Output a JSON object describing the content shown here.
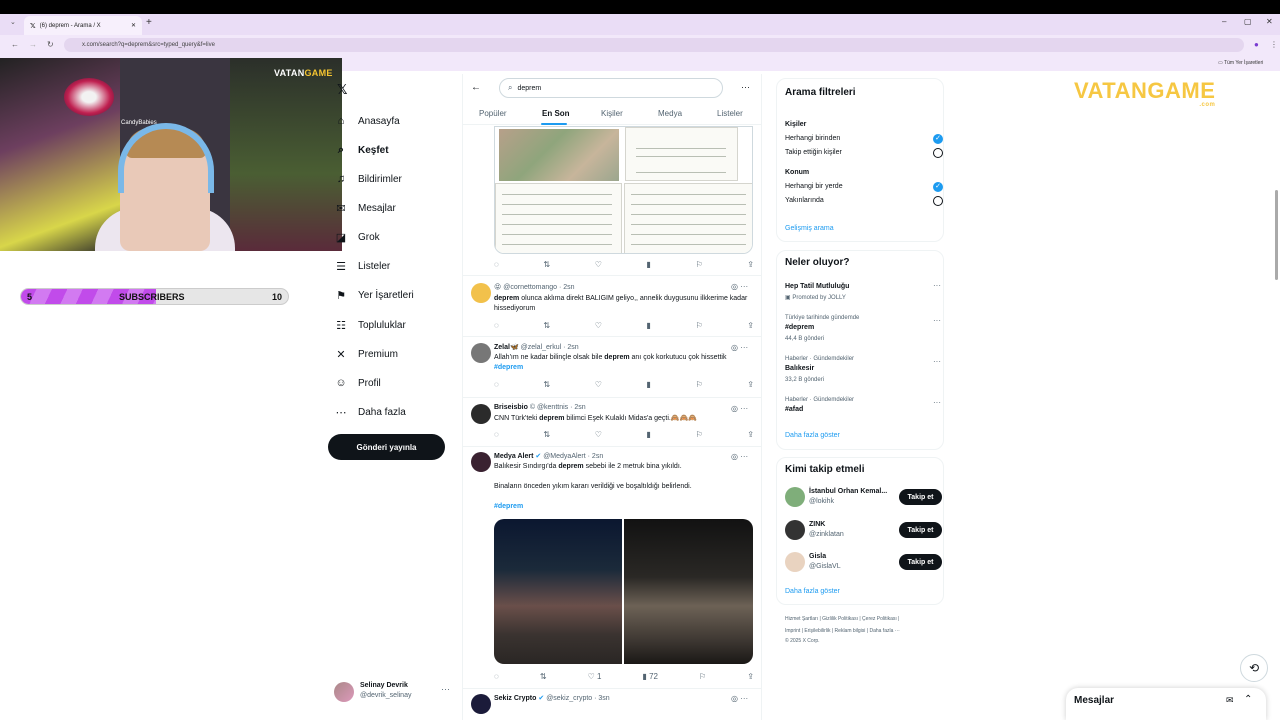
{
  "browser": {
    "tab_title": "(6) deprem - Arama / X",
    "new_tab": "+",
    "url": "x.com/search?q=deprem&src=typed_query&f=live",
    "bookmarks_right": "Tüm Yer İşaretleri",
    "window_min": "–",
    "window_max": "▢",
    "window_close": "✕"
  },
  "stream": {
    "cam_name": "CandyBabies",
    "logo_a": "VATAN",
    "logo_b": "GAME",
    "subs_current": "5",
    "subs_label": "SUBSCRIBERS",
    "subs_goal": "10",
    "subs_fraction": 0.5,
    "right_logo": "VATANGAME",
    "right_logo_sub": ".com"
  },
  "nav": {
    "items": [
      {
        "icon": "home-icon",
        "glyph": "⌂",
        "label": "Anasayfa"
      },
      {
        "icon": "explore-icon",
        "glyph": "⌕",
        "label": "Keşfet"
      },
      {
        "icon": "bell-icon",
        "glyph": "♫",
        "label": "Bildirimler"
      },
      {
        "icon": "mail-icon",
        "glyph": "✉",
        "label": "Mesajlar"
      },
      {
        "icon": "grok-icon",
        "glyph": "◪",
        "label": "Grok"
      },
      {
        "icon": "list-icon",
        "glyph": "☰",
        "label": "Listeler"
      },
      {
        "icon": "bookmark-icon",
        "glyph": "⚑",
        "label": "Yer İşaretleri"
      },
      {
        "icon": "communities-icon",
        "glyph": "☷",
        "label": "Topluluklar"
      },
      {
        "icon": "x-premium-icon",
        "glyph": "✕",
        "label": "Premium"
      },
      {
        "icon": "profile-icon",
        "glyph": "☺",
        "label": "Profil"
      },
      {
        "icon": "more-icon",
        "glyph": "⋯",
        "label": "Daha fazla"
      }
    ],
    "post_button": "Gönderi yayınla",
    "account_name": "Selinay Devrik",
    "account_handle": "@devrik_selinay"
  },
  "search": {
    "query": "deprem",
    "tabs": [
      "Popüler",
      "En Son",
      "Kişiler",
      "Medya",
      "Listeler"
    ],
    "active_tab": "En Son"
  },
  "tweets": [
    {
      "emoji": "😝",
      "name": "",
      "handle": "@cornettomango · 2sn",
      "keyword": "deprem",
      "text": " olunca aklıma direkt BALIGIM geliyo,, annelik duygusunu ilkkerime kadar hissediyorum",
      "stats": {
        "views": ""
      }
    },
    {
      "name": "Zelal",
      "emoji": "🦋",
      "handle": "@zelal_erkul · 2sn",
      "pre": "Allah'ım ne kadar bilinçle olsak bile ",
      "keyword": "deprem",
      "text": " anı çok korkutucu çok hissettik",
      "hashtag": "#deprem"
    },
    {
      "name": "Briseisbio",
      "emoji": "©",
      "handle": "@kenttnis · 2sn",
      "pre": "CNN Türk'teki ",
      "keyword": "deprem",
      "text": " bilimci Eşek Kulaklı Midas'a geçti.🙈🙈🙈"
    },
    {
      "name": "Medya Alert",
      "handle": "@MedyaAlert · 2sn",
      "pre": "Balıkesir Sındırgı'da ",
      "keyword": "deprem",
      "text": " sebebi ile 2 metruk bina yıkıldı.",
      "text2": "Binaların önceden yıkım kararı verildiği ve boşaltıldığı belirlendi.",
      "hashtag": "#deprem",
      "likes": "1",
      "views": "72"
    },
    {
      "name": "Sekiz Crypto",
      "handle": "@sekiz_crypto · 3sn"
    }
  ],
  "right": {
    "filters_title": "Arama filtreleri",
    "people_label": "Kişiler",
    "people_opt1": "Herhangi birinden",
    "people_opt2": "Takip ettiğin kişiler",
    "location_label": "Konum",
    "loc_opt1": "Herhangi bir yerde",
    "loc_opt2": "Yakınlarında",
    "advanced": "Gelişmiş arama",
    "trends_title": "Neler oluyor?",
    "promo_title": "Hep Tatil Mutluluğu",
    "promo_sub": "Promoted by JOLLY",
    "trends": [
      {
        "context": "Türkiye tarihinde gündemde",
        "name": "#deprem",
        "count": "44,4 B gönderi"
      },
      {
        "context": "Haberler · Gündemdekiler",
        "name": "Balıkesir",
        "count": "33,2 B gönderi"
      },
      {
        "context": "Haberler · Gündemdekiler",
        "name": "#afad",
        "count": ""
      }
    ],
    "show_more": "Daha fazla göster",
    "who_title": "Kimi takip etmeli",
    "who": [
      {
        "name": "İstanbul Orhan Kemal...",
        "handle": "@lokihk"
      },
      {
        "name": "ZINK",
        "handle": "@zinklatan"
      },
      {
        "name": "Gisla",
        "handle": "@GislaVL"
      }
    ],
    "follow_label": "Takip et",
    "show_more2": "Daha fazla göster",
    "footer1": "Hizmet Şartları  |  Gizlilik Politikası  |  Çerez Politikası  |",
    "footer2": "Imprint  |  Erişilebilirlik  |  Reklam bilgisi  |  Daha fazla ···",
    "footer3": "© 2025 X Corp.",
    "messages": "Mesajlar"
  },
  "colors": {
    "accent": "#1d9bf0",
    "text": "#0f1419",
    "muted": "#536471",
    "sub_fill": "#c14bea"
  }
}
